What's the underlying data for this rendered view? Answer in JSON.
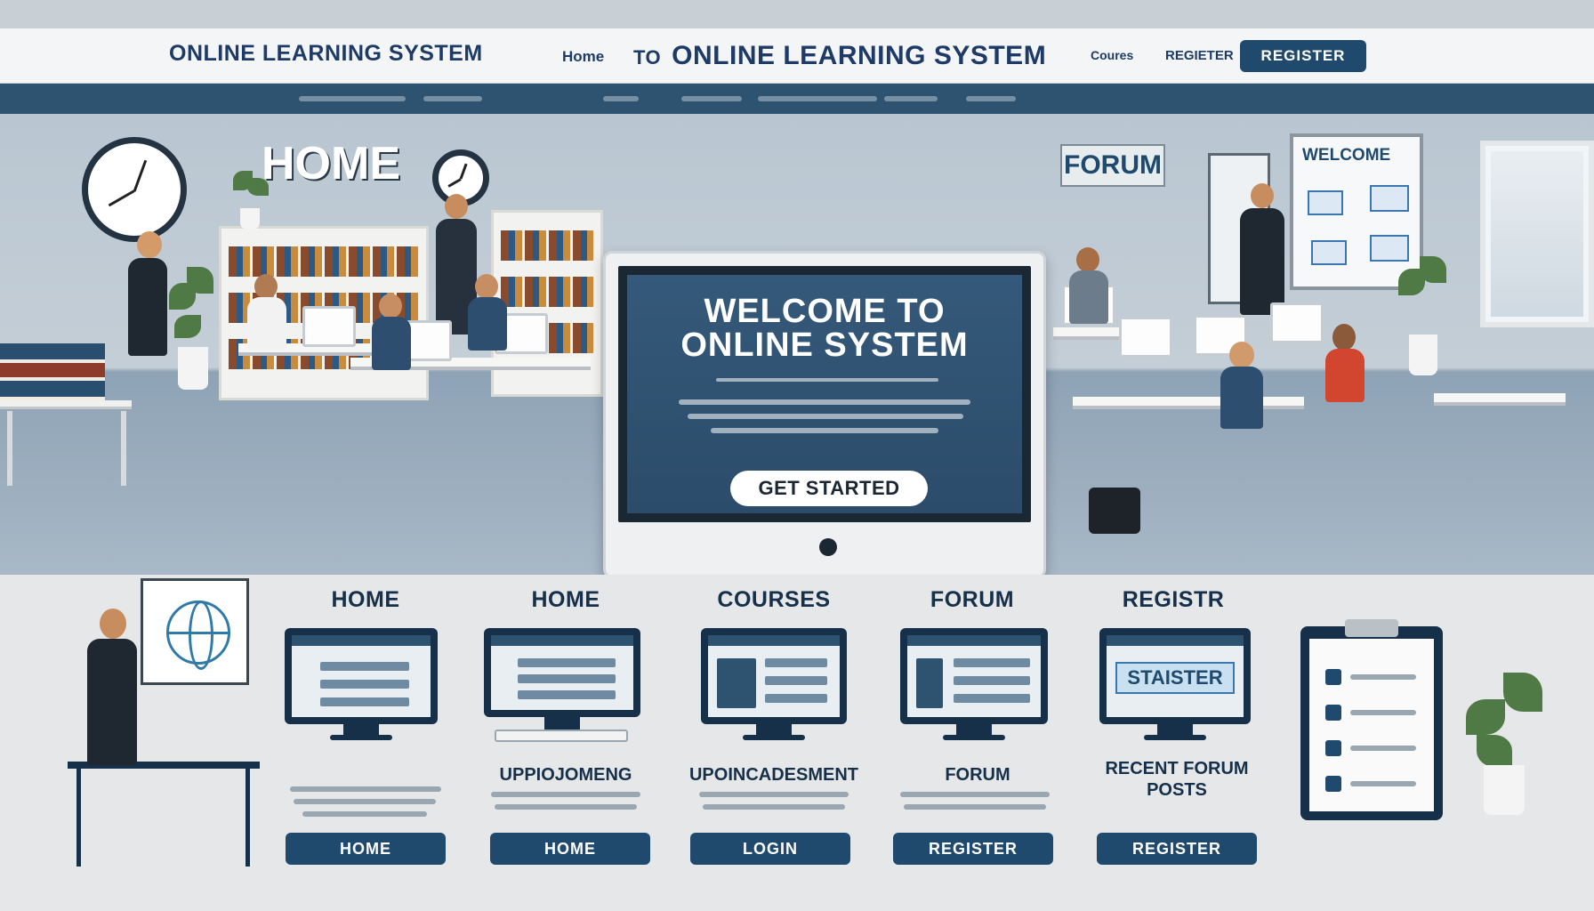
{
  "header": {
    "brand": "ONLINE LEARNING SYSTEM",
    "nav_home": "Home",
    "nav_to": "TO",
    "nav_title": "ONLINE LEARNING SYSTEM",
    "nav_courses": "Coures",
    "nav_register_link": "REGIETER",
    "register_button": "REGISTER"
  },
  "hero": {
    "home_sign": "HOME",
    "forum_sign": "FORUM",
    "whiteboard_title": "WELCOME",
    "screen_line1": "WELCOME TO",
    "screen_line2": "ONLINE SYSTEM",
    "get_started": "GET STARTED"
  },
  "cards": [
    {
      "title": "HOME",
      "subtitle": "",
      "button": "HOME"
    },
    {
      "title": "HOME",
      "subtitle": "UPPIOJOMENG",
      "button": "HOME"
    },
    {
      "title": "COURSES",
      "subtitle": "UPOINCADESMENT",
      "button": "LOGIN"
    },
    {
      "title": "FORUM",
      "subtitle": "FORUM",
      "button": "REGISTER"
    },
    {
      "title": "REGISTR",
      "subtitle": "RECENT FORUM POSTS",
      "button": "REGISTER",
      "screen_label": "STAISTER"
    }
  ],
  "colors": {
    "brand_navy": "#1f4a6e",
    "dark_navy": "#17304a",
    "subnav_blue": "#2e5371"
  }
}
